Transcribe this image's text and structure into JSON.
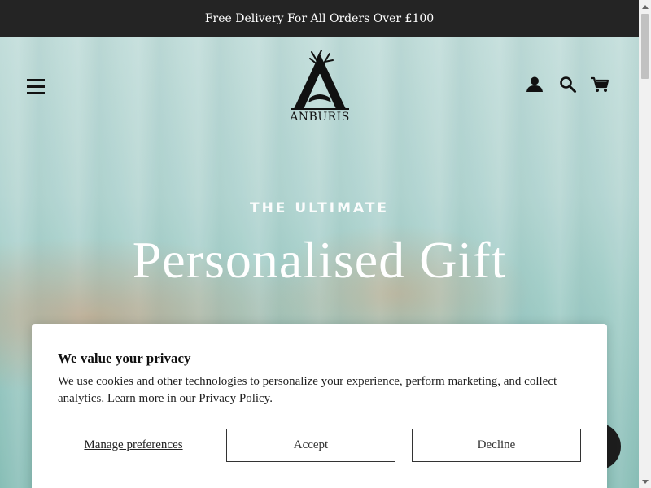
{
  "announcement": {
    "text": "Free Delivery For All Orders Over £100"
  },
  "header": {
    "logo_text": "ANBURIS",
    "icons": [
      "menu-icon",
      "account-icon",
      "search-icon",
      "cart-icon"
    ]
  },
  "hero": {
    "subtitle": "THE ULTIMATE",
    "title": "Personalised Gift"
  },
  "cookie_banner": {
    "title": "We value your privacy",
    "text": "We use cookies and other technologies to personalize your experience, perform marketing, and collect analytics. Learn more in our ",
    "link": "Privacy Policy.",
    "manage_label": "Manage preferences",
    "accept_label": "Accept",
    "decline_label": "Decline"
  },
  "colors": {
    "announcement_bg": "#242424",
    "hero_bg": "#bfe0dc",
    "button_border": "#333333"
  }
}
